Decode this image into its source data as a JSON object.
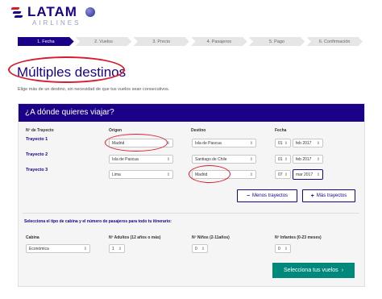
{
  "header": {
    "brand": "LATAM",
    "brand_sub": "AIRLINES",
    "colors": {
      "brand": "#1b0088",
      "accent_red": "#d81c2e",
      "cta": "#00897b"
    }
  },
  "steps": [
    "1. Fecha",
    "2. Vuelos",
    "3. Precio",
    "4. Pasajeros",
    "5. Pago",
    "6. Confirmación"
  ],
  "active_step": 0,
  "page": {
    "title": "Múltiples destinos",
    "subtitle": "Elige más de un destino, sin necesidad de que tus vuelos sean consecutivos."
  },
  "form": {
    "heading": "¿A dónde quieres viajar?",
    "columns": {
      "trayecto": "Nº de Trayecto",
      "origen": "Origen",
      "destino": "Destino",
      "fecha": "Fecha"
    },
    "trips": [
      {
        "label": "Trayecto 1",
        "origen": "Madrid",
        "destino": "Isla de Pascua",
        "dia": "01",
        "mes": "feb 2017"
      },
      {
        "label": "Trayecto 2",
        "origen": "Isla de Pascua",
        "destino": "Santiago de Chile",
        "dia": "01",
        "mes": "feb 2017"
      },
      {
        "label": "Trayecto 3",
        "origen": "Lima",
        "destino": "Madrid",
        "dia": "07",
        "mes": "mar 2017"
      }
    ],
    "less_button": "Menos trayectos",
    "more_button": "Más trayectos",
    "pax_note": "Selecciona el tipo de cabina y el número de pasajeros para todo tu itinerario:",
    "pax": {
      "cabina_label": "Cabina",
      "cabina_value": "Económica",
      "adultos_label": "Nº Adultos (12 años o más)",
      "adultos_value": "1",
      "ninos_label": "Nº Niños (2-11años)",
      "ninos_value": "0",
      "infantes_label": "Nº Infantes (0-23 meses)",
      "infantes_value": "0"
    },
    "submit": "Selecciona tus vuelos"
  }
}
